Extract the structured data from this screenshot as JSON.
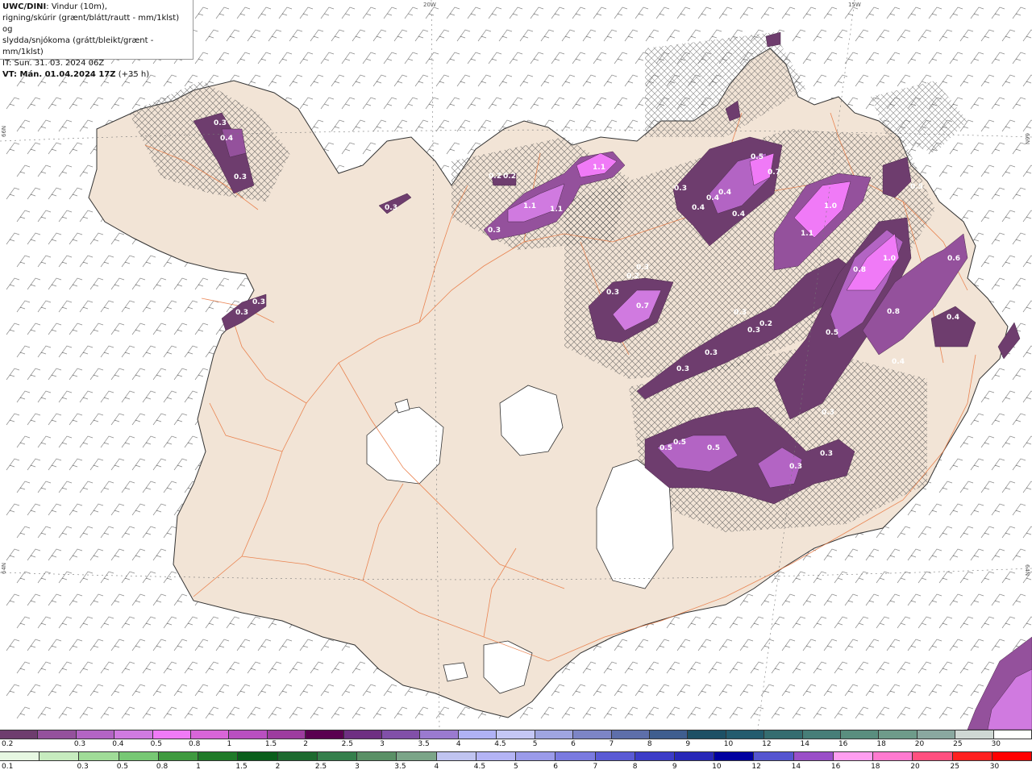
{
  "header": {
    "model_label": "UWC/DINI",
    "line1_rest": ": Vindur (10m),",
    "line2": "rigning/skúrir (grænt/blátt/rautt - mm/1klst) og",
    "line3": "slydda/snjókoma (grátt/bleikt/grænt - mm/1klst)",
    "issue_time": "IT: Sun. 31. 03. 2024 06Z",
    "valid_label": "VT: Mán. 01.04.2024 17Z",
    "valid_offset": " (+35 h)"
  },
  "graticule": {
    "lon_20w": "20W",
    "lon_15w": "15W",
    "lat_66n_left": "66N",
    "lat_66n_right": "66N",
    "lat_64n_left": "64N",
    "lat_64n_right": "64N"
  },
  "precip_labels": [
    "0.3",
    "0.4",
    "0.3",
    "0.3",
    "0.3",
    "0.3",
    "0.2",
    "0.2",
    "1.1",
    "1.1",
    "1.1",
    "0.3",
    "0.3",
    "0.4",
    "0.4",
    "0.4",
    "0.4",
    "0.5",
    "0.7",
    "1.0",
    "1.1",
    "0.3",
    "0.2",
    "0.3",
    "0.7",
    "0.2",
    "0.3",
    "0.3",
    "0.3",
    "0.3",
    "0.8",
    "1.0",
    "0.8",
    "0.6",
    "0.5",
    "0.4",
    "0.4",
    "0.5",
    "0.5",
    "0.3",
    "0.5",
    "0.3",
    "0.5",
    "0.3"
  ],
  "colors": {
    "land": "#f2e4d6",
    "roads": "#e8743b",
    "glacier": "#ffffff",
    "sea": "#ffffff",
    "barb": "#8a8a8a"
  },
  "snow_scale": {
    "labels": [
      "0.2",
      "0.3",
      "0.4",
      "0.5",
      "0.8",
      "1",
      "1.5",
      "2",
      "2.5",
      "3",
      "3.5",
      "4",
      "4.5",
      "5",
      "6",
      "7",
      "8",
      "9",
      "10",
      "12",
      "14",
      "16",
      "18",
      "20",
      "25",
      "30"
    ],
    "colors": [
      "#6e3d6e",
      "#94519c",
      "#b364c4",
      "#d07ae0",
      "#f07af7",
      "#d865d8",
      "#b94fc0",
      "#9d3c9f",
      "#5a0050",
      "#6e2f82",
      "#8150a8",
      "#9a7ad0",
      "#b0b2f5",
      "#c4c7f5",
      "#9fa5e0",
      "#7d85c6",
      "#5e6faa",
      "#3f5e8f",
      "#1d5065",
      "#245c6e",
      "#356d70",
      "#477e78",
      "#5a8e7f",
      "#6e9b8a",
      "#8aa8a0",
      "#cfd8d4",
      "#ffffff"
    ]
  },
  "rain_scale": {
    "labels": [
      "0.1",
      "0.3",
      "0.5",
      "0.8",
      "1",
      "1.5",
      "2",
      "2.5",
      "3",
      "3.5",
      "4",
      "4.5",
      "5",
      "6",
      "7",
      "8",
      "9",
      "10",
      "12",
      "14",
      "16",
      "18",
      "20",
      "25",
      "30"
    ],
    "colors": [
      "#e7f8e2",
      "#c7ecbf",
      "#a0dc98",
      "#77c874",
      "#3f9a3f",
      "#1f7a28",
      "#0a5e1b",
      "#1d6a2f",
      "#357f4c",
      "#5a9066",
      "#7ba588",
      "#c0c4f0",
      "#b4b4f5",
      "#9b9bea",
      "#7a7ae0",
      "#5a5ad5",
      "#3c3cc8",
      "#2828b8",
      "#0000a0",
      "#5555d0",
      "#9a4fc8",
      "#ff9ef0",
      "#ff7ad0",
      "#ff5080",
      "#ff2020",
      "#ff0000"
    ]
  }
}
